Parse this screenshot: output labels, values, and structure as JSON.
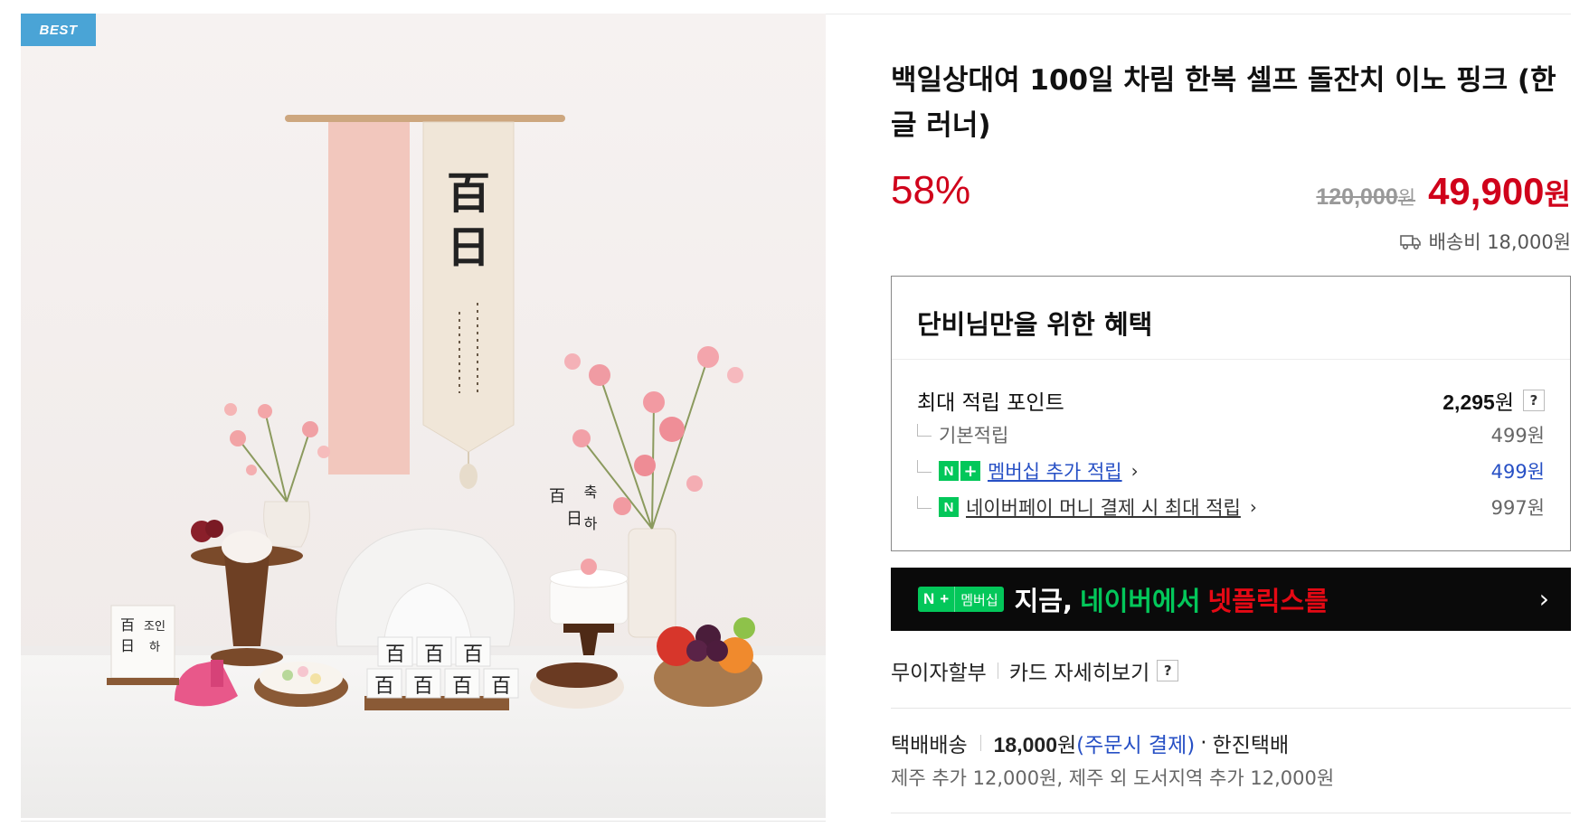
{
  "badge": {
    "label": "BEST"
  },
  "image": {
    "hanging_large": "百日",
    "board_left": [
      "百",
      "조인",
      "日",
      "하"
    ],
    "sign_center": [
      "百",
      "日",
      "축",
      "하"
    ],
    "blocks": [
      "百",
      "百",
      "百",
      "百",
      "百",
      "百",
      "百"
    ]
  },
  "product": {
    "title": "백일상대여 100일 차림 한복 셀프 돌잔치 이노 핑크 (한글 러너)",
    "discount": "58%",
    "original_price": "120,000",
    "original_price_unit": "원",
    "sale_price": "49,900",
    "sale_price_unit": "원",
    "shipping_text": "배송비 18,000원"
  },
  "benefit": {
    "title": "단비님만을 위한 혜택",
    "max_label": "최대 적립 포인트",
    "max_value": "2,295",
    "max_unit": "원",
    "help": "?",
    "rows": [
      {
        "label": "기본적립",
        "value": "499원"
      },
      {
        "label": "멤버십 추가 적립",
        "value": "499원",
        "badge_n": "N",
        "badge_plus": "+"
      },
      {
        "label": "네이버페이 머니 결제 시 최대 적립",
        "value": "997원",
        "badge_n": "N"
      }
    ]
  },
  "banner": {
    "badge_n": "N",
    "badge_plus": "+",
    "badge_label": "멤버십",
    "text1": "지금,",
    "text2": "네이버에서",
    "text3": "넷플릭스를",
    "arrow": "›"
  },
  "installment": {
    "label": "무이자할부",
    "card_link": "카드 자세히보기",
    "help": "?"
  },
  "delivery": {
    "method": "택배배송",
    "fee": "18,000",
    "fee_unit": "원",
    "fee_note": "(주문시 결제)",
    "carrier": "한진택배",
    "extra": "제주 추가 12,000원, 제주 외 도서지역 추가 12,000원"
  },
  "colors": {
    "accent_red": "#d0021b",
    "naver_green": "#03c75a",
    "link_blue": "#2750c5",
    "badge_blue": "#4aa4d6"
  }
}
